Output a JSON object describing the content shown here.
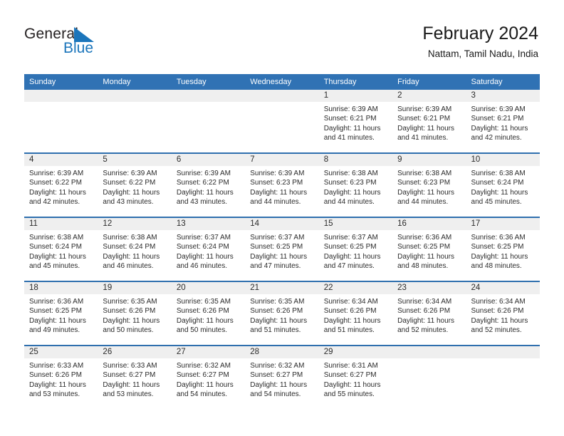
{
  "logo": {
    "word_top": "General",
    "word_bottom": "Blue",
    "triangle_color": "#1b75bb",
    "text_color": "#231f20"
  },
  "header": {
    "title": "February 2024",
    "subtitle": "Nattam, Tamil Nadu, India"
  },
  "theme": {
    "header_blue": "#3072b4",
    "row_divider_blue": "#2f6fae",
    "daynum_band": "#efefef"
  },
  "calendar": {
    "weekday_headers": [
      "Sunday",
      "Monday",
      "Tuesday",
      "Wednesday",
      "Thursday",
      "Friday",
      "Saturday"
    ],
    "weeks": [
      [
        {
          "day": "",
          "sunrise": "",
          "sunset": "",
          "daylight_l1": "",
          "daylight_l2": ""
        },
        {
          "day": "",
          "sunrise": "",
          "sunset": "",
          "daylight_l1": "",
          "daylight_l2": ""
        },
        {
          "day": "",
          "sunrise": "",
          "sunset": "",
          "daylight_l1": "",
          "daylight_l2": ""
        },
        {
          "day": "",
          "sunrise": "",
          "sunset": "",
          "daylight_l1": "",
          "daylight_l2": ""
        },
        {
          "day": "1",
          "sunrise": "Sunrise: 6:39 AM",
          "sunset": "Sunset: 6:21 PM",
          "daylight_l1": "Daylight: 11 hours",
          "daylight_l2": "and 41 minutes."
        },
        {
          "day": "2",
          "sunrise": "Sunrise: 6:39 AM",
          "sunset": "Sunset: 6:21 PM",
          "daylight_l1": "Daylight: 11 hours",
          "daylight_l2": "and 41 minutes."
        },
        {
          "day": "3",
          "sunrise": "Sunrise: 6:39 AM",
          "sunset": "Sunset: 6:21 PM",
          "daylight_l1": "Daylight: 11 hours",
          "daylight_l2": "and 42 minutes."
        }
      ],
      [
        {
          "day": "4",
          "sunrise": "Sunrise: 6:39 AM",
          "sunset": "Sunset: 6:22 PM",
          "daylight_l1": "Daylight: 11 hours",
          "daylight_l2": "and 42 minutes."
        },
        {
          "day": "5",
          "sunrise": "Sunrise: 6:39 AM",
          "sunset": "Sunset: 6:22 PM",
          "daylight_l1": "Daylight: 11 hours",
          "daylight_l2": "and 43 minutes."
        },
        {
          "day": "6",
          "sunrise": "Sunrise: 6:39 AM",
          "sunset": "Sunset: 6:22 PM",
          "daylight_l1": "Daylight: 11 hours",
          "daylight_l2": "and 43 minutes."
        },
        {
          "day": "7",
          "sunrise": "Sunrise: 6:39 AM",
          "sunset": "Sunset: 6:23 PM",
          "daylight_l1": "Daylight: 11 hours",
          "daylight_l2": "and 44 minutes."
        },
        {
          "day": "8",
          "sunrise": "Sunrise: 6:38 AM",
          "sunset": "Sunset: 6:23 PM",
          "daylight_l1": "Daylight: 11 hours",
          "daylight_l2": "and 44 minutes."
        },
        {
          "day": "9",
          "sunrise": "Sunrise: 6:38 AM",
          "sunset": "Sunset: 6:23 PM",
          "daylight_l1": "Daylight: 11 hours",
          "daylight_l2": "and 44 minutes."
        },
        {
          "day": "10",
          "sunrise": "Sunrise: 6:38 AM",
          "sunset": "Sunset: 6:24 PM",
          "daylight_l1": "Daylight: 11 hours",
          "daylight_l2": "and 45 minutes."
        }
      ],
      [
        {
          "day": "11",
          "sunrise": "Sunrise: 6:38 AM",
          "sunset": "Sunset: 6:24 PM",
          "daylight_l1": "Daylight: 11 hours",
          "daylight_l2": "and 45 minutes."
        },
        {
          "day": "12",
          "sunrise": "Sunrise: 6:38 AM",
          "sunset": "Sunset: 6:24 PM",
          "daylight_l1": "Daylight: 11 hours",
          "daylight_l2": "and 46 minutes."
        },
        {
          "day": "13",
          "sunrise": "Sunrise: 6:37 AM",
          "sunset": "Sunset: 6:24 PM",
          "daylight_l1": "Daylight: 11 hours",
          "daylight_l2": "and 46 minutes."
        },
        {
          "day": "14",
          "sunrise": "Sunrise: 6:37 AM",
          "sunset": "Sunset: 6:25 PM",
          "daylight_l1": "Daylight: 11 hours",
          "daylight_l2": "and 47 minutes."
        },
        {
          "day": "15",
          "sunrise": "Sunrise: 6:37 AM",
          "sunset": "Sunset: 6:25 PM",
          "daylight_l1": "Daylight: 11 hours",
          "daylight_l2": "and 47 minutes."
        },
        {
          "day": "16",
          "sunrise": "Sunrise: 6:36 AM",
          "sunset": "Sunset: 6:25 PM",
          "daylight_l1": "Daylight: 11 hours",
          "daylight_l2": "and 48 minutes."
        },
        {
          "day": "17",
          "sunrise": "Sunrise: 6:36 AM",
          "sunset": "Sunset: 6:25 PM",
          "daylight_l1": "Daylight: 11 hours",
          "daylight_l2": "and 48 minutes."
        }
      ],
      [
        {
          "day": "18",
          "sunrise": "Sunrise: 6:36 AM",
          "sunset": "Sunset: 6:25 PM",
          "daylight_l1": "Daylight: 11 hours",
          "daylight_l2": "and 49 minutes."
        },
        {
          "day": "19",
          "sunrise": "Sunrise: 6:35 AM",
          "sunset": "Sunset: 6:26 PM",
          "daylight_l1": "Daylight: 11 hours",
          "daylight_l2": "and 50 minutes."
        },
        {
          "day": "20",
          "sunrise": "Sunrise: 6:35 AM",
          "sunset": "Sunset: 6:26 PM",
          "daylight_l1": "Daylight: 11 hours",
          "daylight_l2": "and 50 minutes."
        },
        {
          "day": "21",
          "sunrise": "Sunrise: 6:35 AM",
          "sunset": "Sunset: 6:26 PM",
          "daylight_l1": "Daylight: 11 hours",
          "daylight_l2": "and 51 minutes."
        },
        {
          "day": "22",
          "sunrise": "Sunrise: 6:34 AM",
          "sunset": "Sunset: 6:26 PM",
          "daylight_l1": "Daylight: 11 hours",
          "daylight_l2": "and 51 minutes."
        },
        {
          "day": "23",
          "sunrise": "Sunrise: 6:34 AM",
          "sunset": "Sunset: 6:26 PM",
          "daylight_l1": "Daylight: 11 hours",
          "daylight_l2": "and 52 minutes."
        },
        {
          "day": "24",
          "sunrise": "Sunrise: 6:34 AM",
          "sunset": "Sunset: 6:26 PM",
          "daylight_l1": "Daylight: 11 hours",
          "daylight_l2": "and 52 minutes."
        }
      ],
      [
        {
          "day": "25",
          "sunrise": "Sunrise: 6:33 AM",
          "sunset": "Sunset: 6:26 PM",
          "daylight_l1": "Daylight: 11 hours",
          "daylight_l2": "and 53 minutes."
        },
        {
          "day": "26",
          "sunrise": "Sunrise: 6:33 AM",
          "sunset": "Sunset: 6:27 PM",
          "daylight_l1": "Daylight: 11 hours",
          "daylight_l2": "and 53 minutes."
        },
        {
          "day": "27",
          "sunrise": "Sunrise: 6:32 AM",
          "sunset": "Sunset: 6:27 PM",
          "daylight_l1": "Daylight: 11 hours",
          "daylight_l2": "and 54 minutes."
        },
        {
          "day": "28",
          "sunrise": "Sunrise: 6:32 AM",
          "sunset": "Sunset: 6:27 PM",
          "daylight_l1": "Daylight: 11 hours",
          "daylight_l2": "and 54 minutes."
        },
        {
          "day": "29",
          "sunrise": "Sunrise: 6:31 AM",
          "sunset": "Sunset: 6:27 PM",
          "daylight_l1": "Daylight: 11 hours",
          "daylight_l2": "and 55 minutes."
        },
        {
          "day": "",
          "sunrise": "",
          "sunset": "",
          "daylight_l1": "",
          "daylight_l2": ""
        },
        {
          "day": "",
          "sunrise": "",
          "sunset": "",
          "daylight_l1": "",
          "daylight_l2": ""
        }
      ]
    ]
  }
}
